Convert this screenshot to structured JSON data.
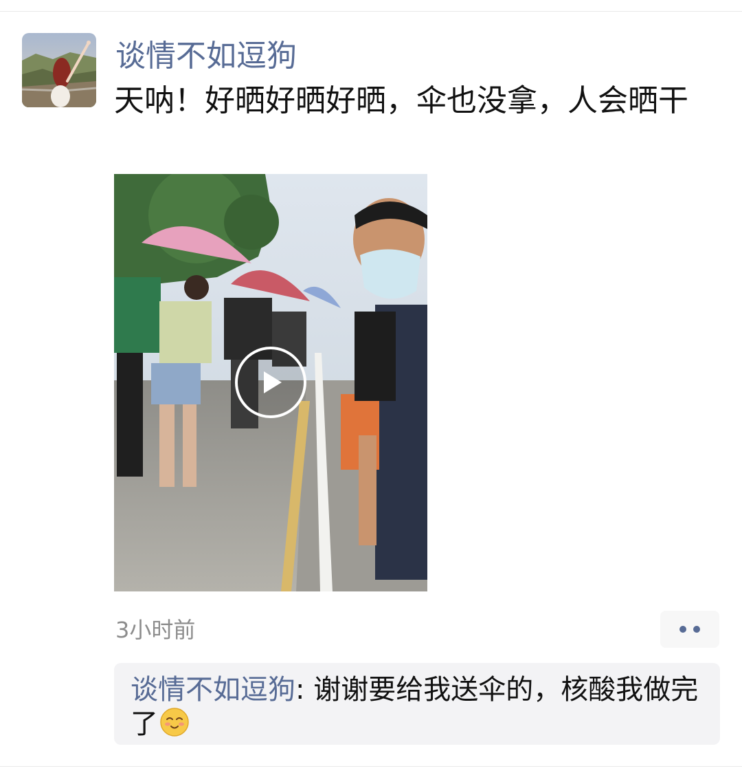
{
  "post": {
    "author": "谈情不如逗狗",
    "text": "天呐！好晒好晒好晒，伞也没拿，人会晒干",
    "timestamp": "3小时前"
  },
  "media": {
    "type": "video",
    "play_icon": "play-icon"
  },
  "more_button": {
    "icon": "more-dots-icon"
  },
  "comment": {
    "commenter": "谈情不如逗狗",
    "separator": ": ",
    "text": "谢谢要给我送伞的，核酸我做完了",
    "emoji": "blush-smile-emoji"
  },
  "colors": {
    "link": "#576b95",
    "text": "#111111",
    "meta": "#8c8c8c",
    "comment_bg": "#f3f3f5"
  }
}
